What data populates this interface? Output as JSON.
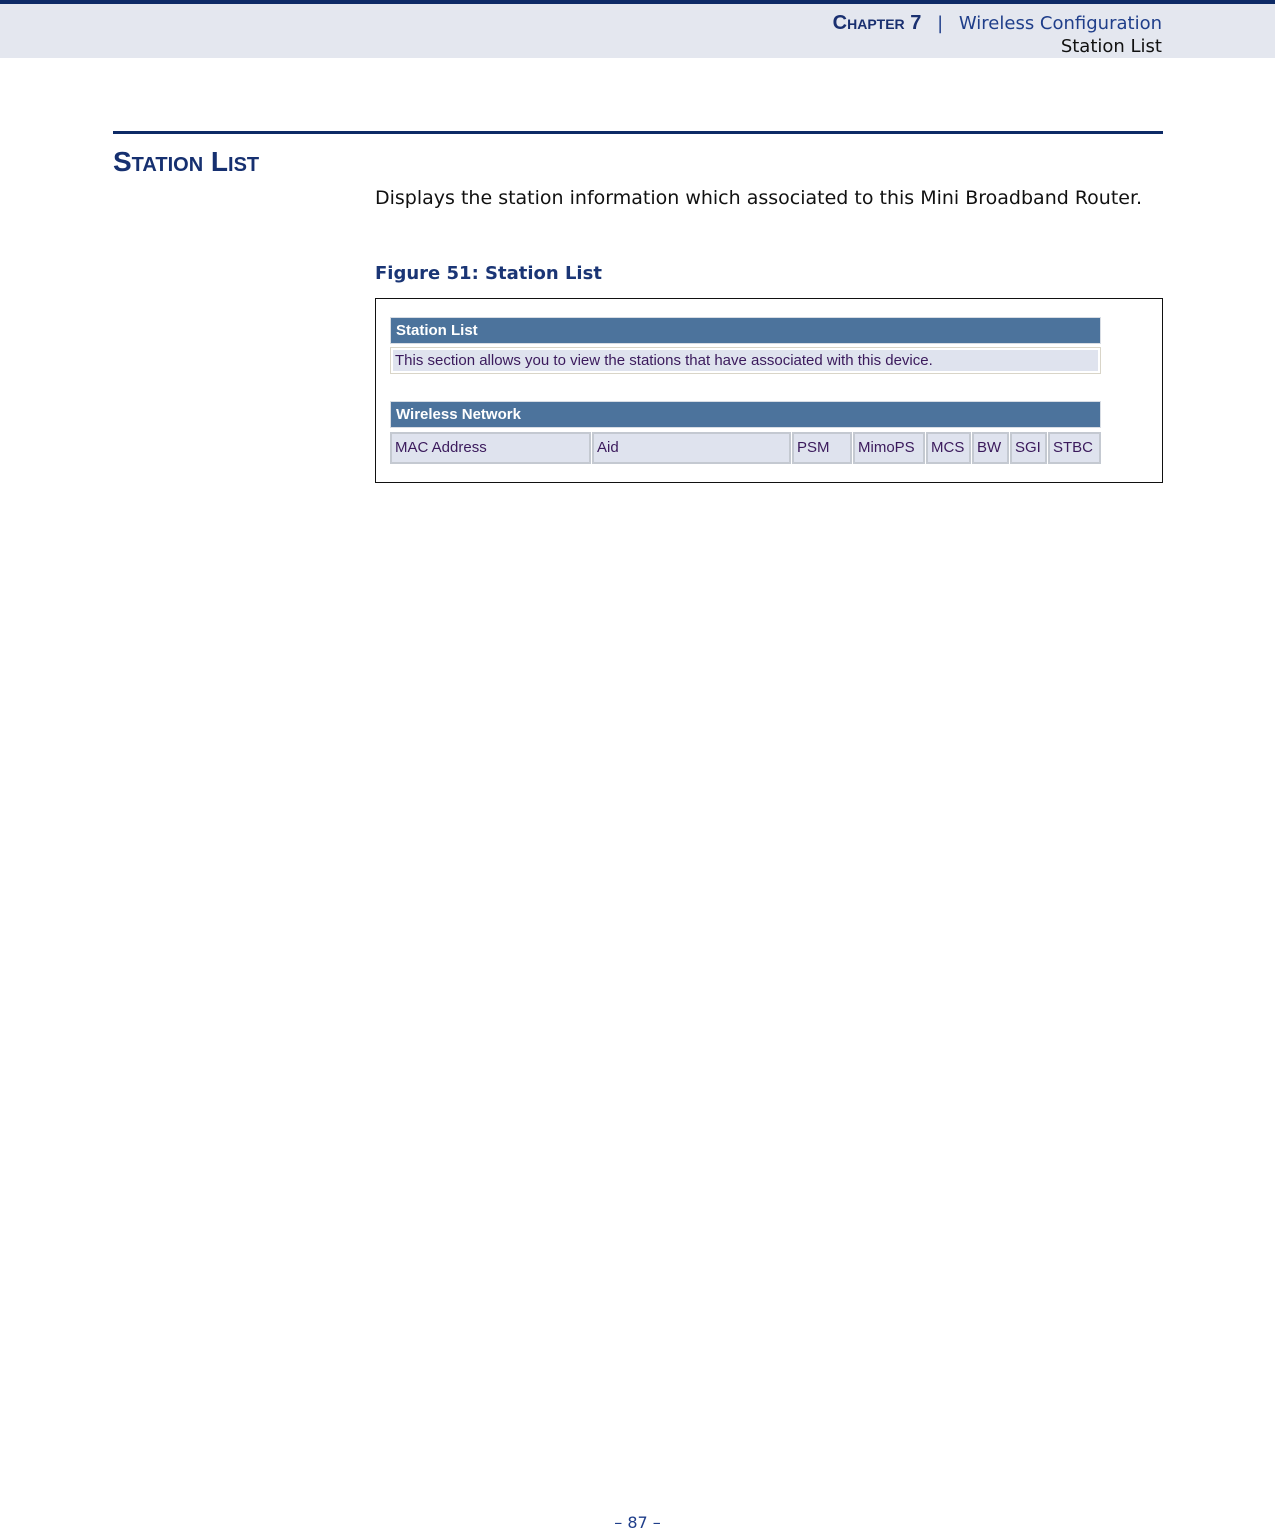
{
  "header": {
    "chapter_label": "Chapter 7",
    "separator": "|",
    "chapter_title": "Wireless Configuration",
    "section": "Station List"
  },
  "section": {
    "title": "Station List",
    "description": "Displays the station information which associated to this Mini Broadband Router."
  },
  "figure": {
    "caption": "Figure 51:  Station List",
    "panel_title": "Station List",
    "panel_description": "This section allows you to view the stations that have associated with this device.",
    "table_title": "Wireless Network",
    "columns": [
      "MAC Address",
      "Aid",
      "PSM",
      "MimoPS",
      "MCS",
      "BW",
      "SGI",
      "STBC"
    ],
    "colors": {
      "bar_background": "#4c739c",
      "cell_background": "#dfe3ee",
      "cell_text": "#3b1a5c"
    }
  },
  "footer": {
    "page_number": "–  87  –"
  }
}
